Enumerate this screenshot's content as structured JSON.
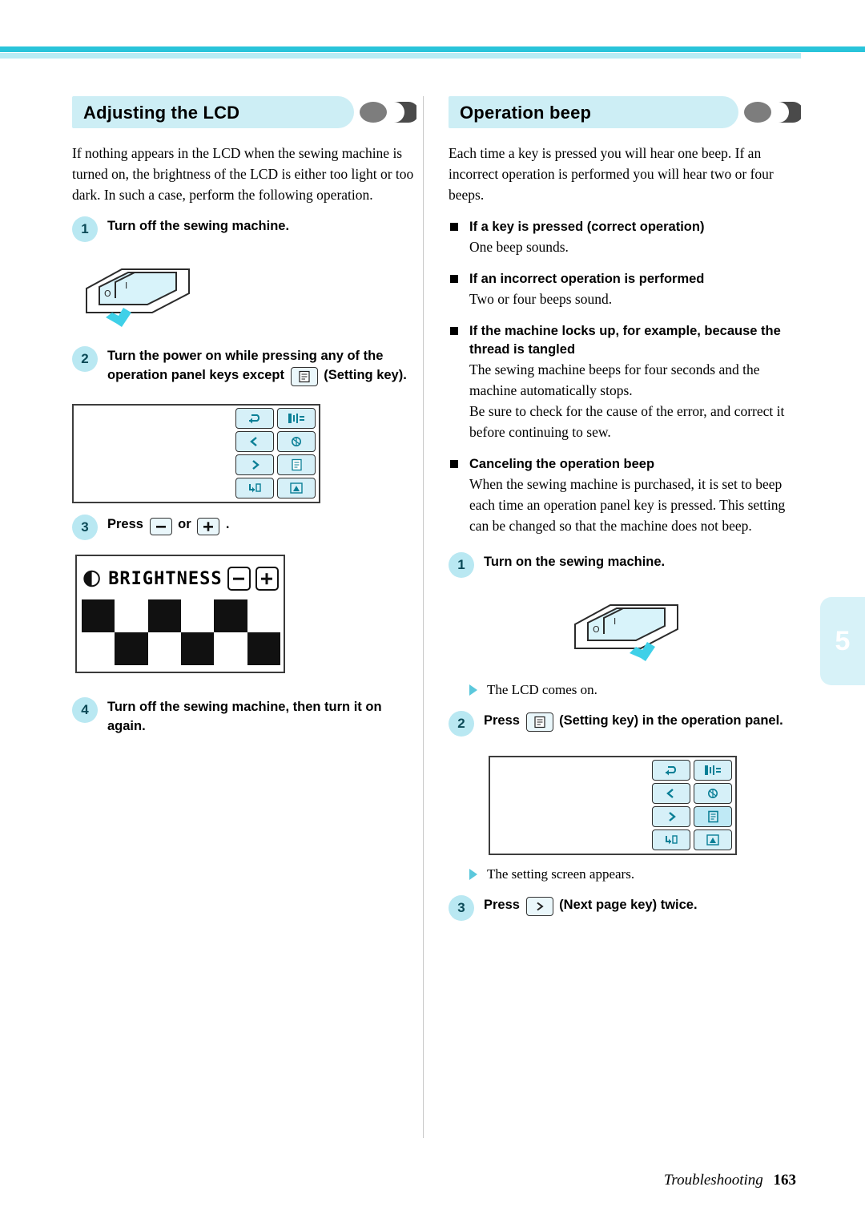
{
  "meta": {
    "accent_cyan": "#29c4da",
    "accent_light": "#b9ecf4",
    "key_fill": "#d6f0f8"
  },
  "footer": {
    "chapter": "Troubleshooting",
    "page": "163"
  },
  "chapter_tab": {
    "number": "5"
  },
  "left": {
    "heading": "Adjusting the LCD",
    "intro": "If nothing appears in the LCD when the sewing machine is turned on, the brightness of the LCD is either too light or too dark. In such a case, perform the following operation.",
    "step1": {
      "num": "1",
      "text": "Turn off the sewing machine."
    },
    "step2": {
      "num": "2",
      "text_a": "Turn the power on while pressing any of the operation panel keys except",
      "text_b": "(Setting key)."
    },
    "step3": {
      "num": "3",
      "text_a": "Press",
      "text_b": "or",
      "text_c": "."
    },
    "step4": {
      "num": "4",
      "text": "Turn off the sewing machine, then turn it on again."
    },
    "lcd": {
      "title": "BRIGHTNESS",
      "minus": "–",
      "plus": "+"
    }
  },
  "right": {
    "heading": "Operation beep",
    "intro": "Each time a key is pressed you will hear one beep. If an incorrect operation is performed you will hear two or four beeps.",
    "bullets": [
      {
        "title": "If a key is pressed (correct operation)",
        "body": "One beep sounds."
      },
      {
        "title": "If an incorrect operation is performed",
        "body": "Two or four beeps sound."
      },
      {
        "title": "If the machine locks up, for example, because the thread is tangled",
        "body": "The sewing machine beeps for four seconds and the machine automatically stops.\nBe sure to check for the cause of the error, and correct it before continuing to sew."
      },
      {
        "title": "Canceling the operation beep",
        "body": "When the sewing machine is purchased, it is set to beep each time an operation panel key is pressed. This setting can be changed so that the machine does not beep."
      }
    ],
    "step1": {
      "num": "1",
      "text": "Turn on the sewing machine."
    },
    "result1": "The LCD comes on.",
    "step2": {
      "num": "2",
      "text_a": "Press",
      "text_b": "(Setting key) in the operation panel."
    },
    "result2": "The setting screen appears.",
    "step3": {
      "num": "3",
      "text_a": "Press",
      "text_b": "(Next page key) twice."
    }
  },
  "panel_keys": {
    "left_panel": [
      "return-key",
      "back-key",
      "next-page-key",
      "reverse-stitch-key"
    ],
    "right_panel": [
      "needle-position-key",
      "thread-cutter-key",
      "setting-key",
      "presser-foot-key"
    ]
  }
}
